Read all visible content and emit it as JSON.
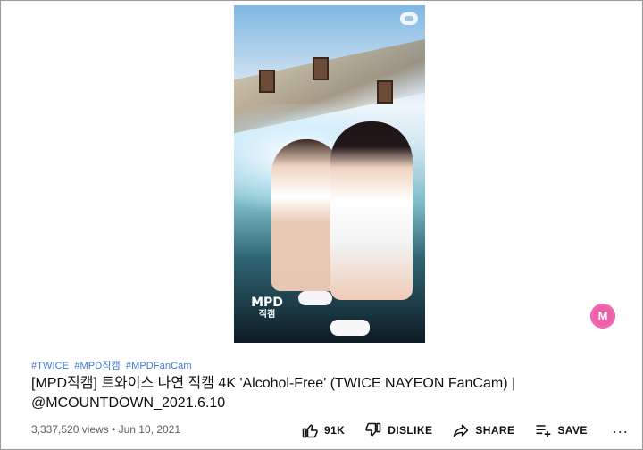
{
  "video": {
    "watermark_main": "MPD",
    "watermark_sub": "직캠"
  },
  "channel_logo": "M",
  "hashtags": [
    "#TWICE",
    "#MPD직캠",
    "#MPDFanCam"
  ],
  "title_line1": "[MPD직캠] 트와이스 나연 직캠 4K 'Alcohol-Free' (TWICE NAYEON FanCam) |",
  "title_line2": "@MCOUNTDOWN_2021.6.10",
  "views": "3,337,520 views",
  "date": "Jun 10, 2021",
  "actions": {
    "like_count": "91K",
    "dislike_label": "DISLIKE",
    "share_label": "SHARE",
    "save_label": "SAVE",
    "more_label": "..."
  },
  "colors": {
    "hashtag": "#3d7bd1",
    "logo_pink": "#ef5fa9",
    "meta_gray": "#606060"
  },
  "icons": [
    "thumbs-up-icon",
    "thumbs-down-icon",
    "share-arrow-icon",
    "playlist-add-icon",
    "more-icon"
  ]
}
